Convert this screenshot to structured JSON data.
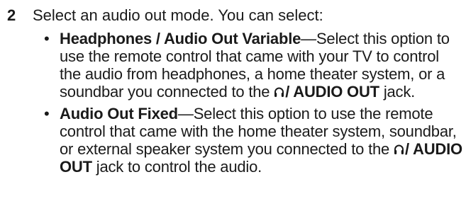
{
  "step": {
    "number": "2",
    "text": "Select an audio out mode. You can select:"
  },
  "options": [
    {
      "title": "Headphones / Audio Out Variable",
      "desc": "—Select this option to use the remote control that came with your TV to control the audio from headphones, a home theater system, or a soundbar you connected to the",
      "jack": "/ AUDIO OUT",
      "tail": "jack."
    },
    {
      "title": "Audio Out Fixed",
      "desc": "—Select this option to use the remote control that came with the home theater system, soundbar, or external speaker system you connected to the",
      "jack": "/ AUDIO OUT",
      "tail": "jack to control the audio."
    }
  ],
  "icons": {
    "jack_icon": "headphones-icon",
    "bullet_glyph": "•"
  }
}
